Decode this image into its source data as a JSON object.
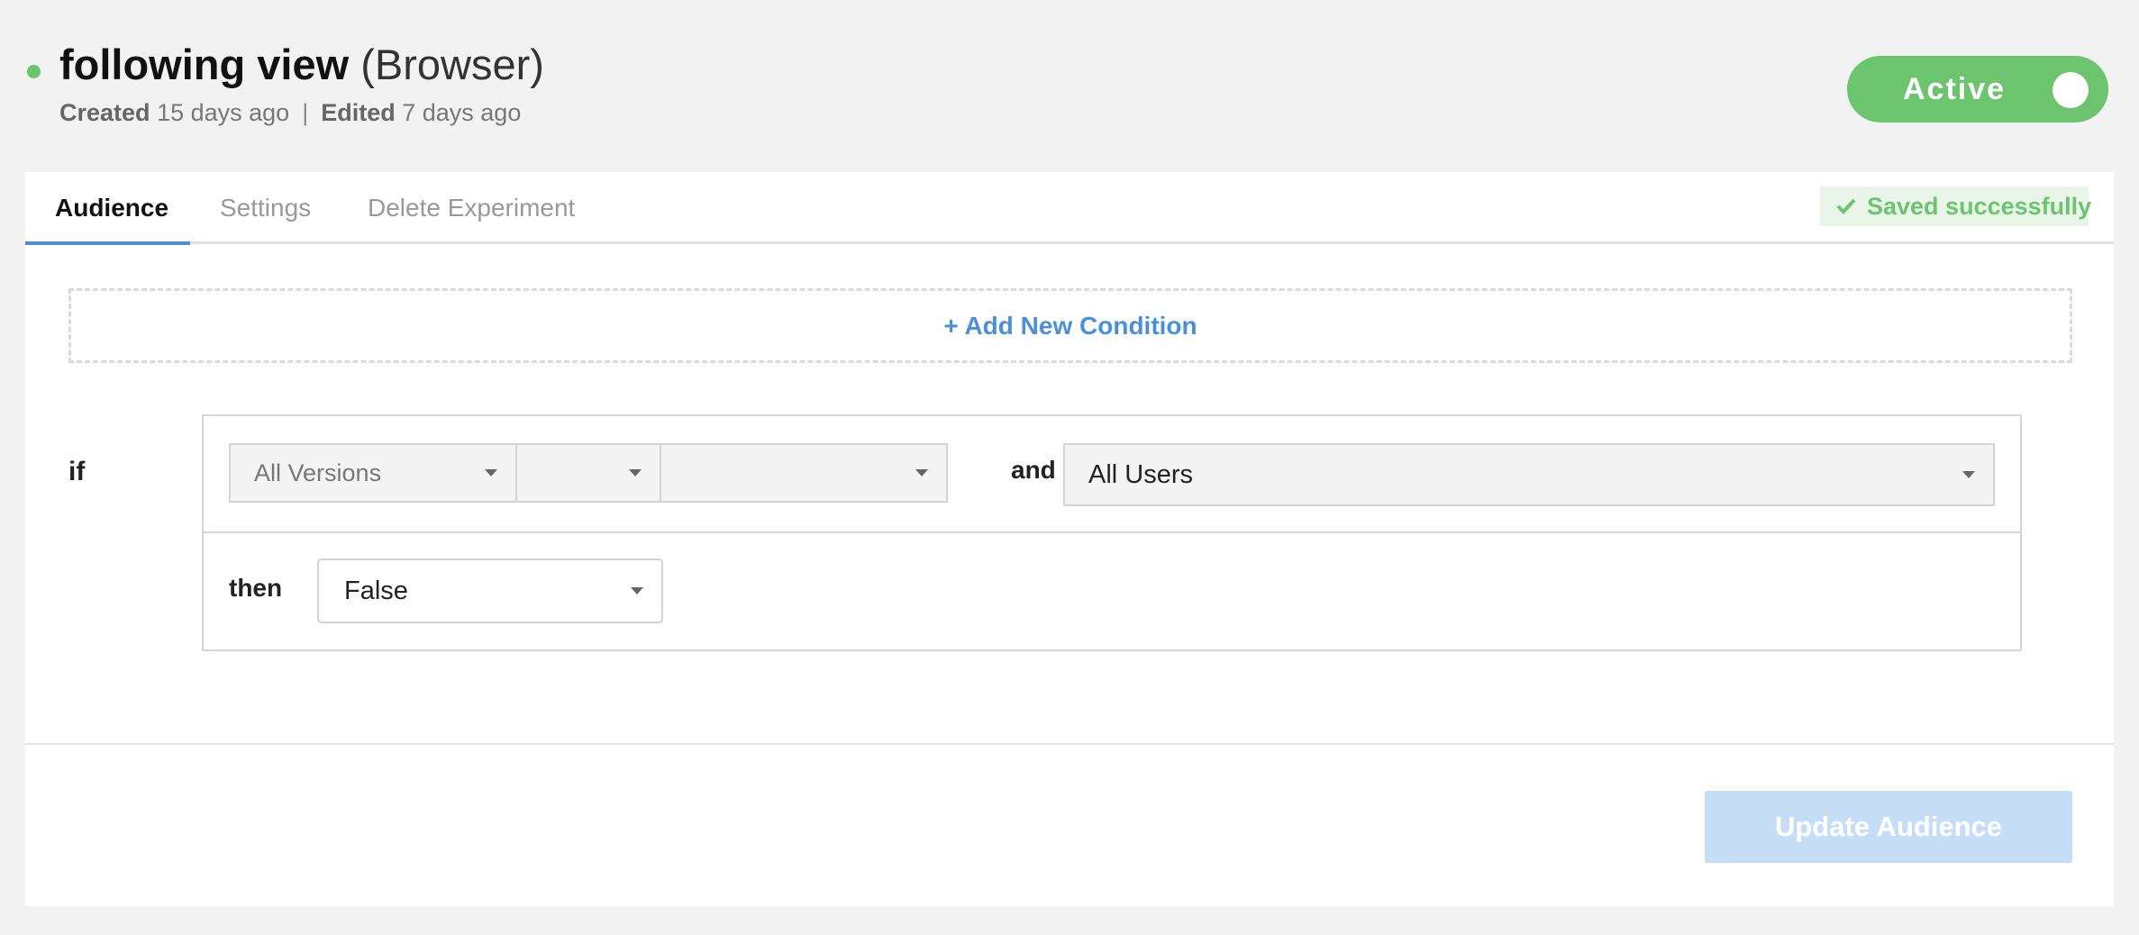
{
  "header": {
    "title": "following view",
    "platform": "(Browser)",
    "created_label": "Created",
    "created_value": "15 days ago",
    "separator": "|",
    "edited_label": "Edited",
    "edited_value": "7 days ago",
    "toggle_label": "Active",
    "toggle_on": true
  },
  "tabs": [
    {
      "label": "Audience",
      "active": true
    },
    {
      "label": "Settings",
      "active": false
    },
    {
      "label": "Delete Experiment",
      "active": false
    }
  ],
  "saved_status": "Saved successfully",
  "add_condition_label": "+ Add New Condition",
  "rule": {
    "if_label": "if",
    "version_select": "All Versions",
    "operator_select": "",
    "value_select": "",
    "and_label": "and",
    "users_select": "All Users",
    "then_label": "then",
    "then_select": "False"
  },
  "update_button_label": "Update Audience",
  "colors": {
    "active_green": "#6cc46f",
    "accent_blue": "#4a90d9",
    "disabled_button": "#c5ddf5"
  }
}
